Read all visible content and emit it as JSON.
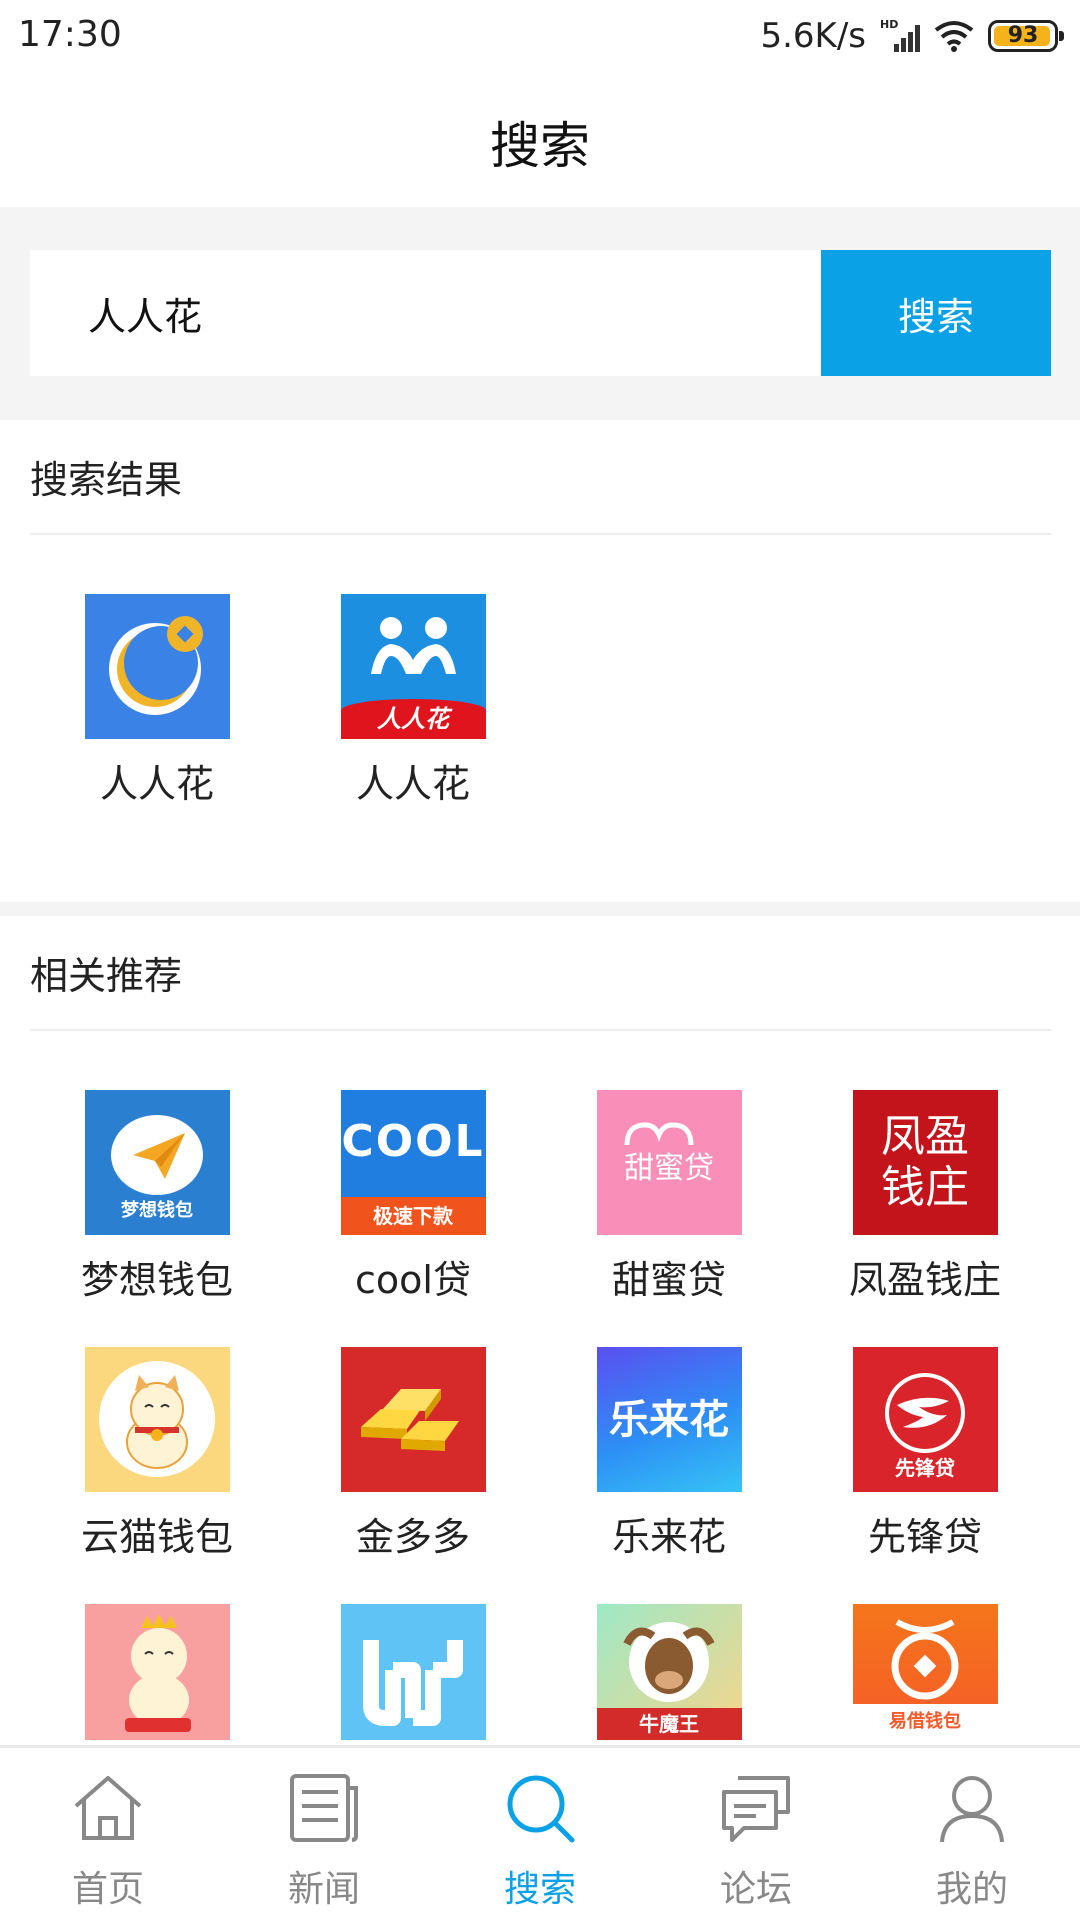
{
  "status_bar": {
    "time": "17:30",
    "net_speed": "5.6K/s",
    "signal_label": "HD",
    "battery": "93",
    "battery_color": "#f5b21b"
  },
  "header": {
    "title": "搜索"
  },
  "search": {
    "value": "人人花",
    "button_label": "搜索",
    "accent_color": "#0aa1e6"
  },
  "results": {
    "title": "搜索结果",
    "items": [
      {
        "label": "人人花",
        "icon": "blue-ring-coin-icon"
      },
      {
        "label": "人人花",
        "icon": "renrenhua-people-icon",
        "icon_text": "人人花"
      }
    ]
  },
  "recommend": {
    "title": "相关推荐",
    "items": [
      {
        "label": "梦想钱包",
        "icon": "paper-plane-icon",
        "icon_text": "梦想钱包"
      },
      {
        "label": "cool贷",
        "icon": "cool-coins-icon",
        "icon_text": "极速下款",
        "icon_word": "COOL"
      },
      {
        "label": "甜蜜贷",
        "icon": "heart-icon",
        "icon_text": "甜蜜贷"
      },
      {
        "label": "凤盈钱庄",
        "icon": "fengying-text-icon",
        "icon_text": "凤盈钱庄"
      },
      {
        "label": "云猫钱包",
        "icon": "lucky-cat-icon"
      },
      {
        "label": "金多多",
        "icon": "gold-bars-icon"
      },
      {
        "label": "乐来花",
        "icon": "lelaihua-text-icon",
        "icon_text": "乐来花"
      },
      {
        "label": "先锋贷",
        "icon": "xianfeng-logo-icon",
        "icon_text": "先锋贷"
      },
      {
        "label": "",
        "icon": "crowned-cat-icon"
      },
      {
        "label": "",
        "icon": "w-logo-icon"
      },
      {
        "label": "",
        "icon": "bull-king-icon",
        "icon_text": "牛魔王"
      },
      {
        "label": "",
        "icon": "yijie-wallet-icon",
        "icon_text": "易借钱包"
      }
    ]
  },
  "bottom_nav": {
    "items": [
      {
        "label": "首页",
        "icon": "home-icon"
      },
      {
        "label": "新闻",
        "icon": "news-icon"
      },
      {
        "label": "搜索",
        "icon": "search-icon",
        "active": true
      },
      {
        "label": "论坛",
        "icon": "forum-icon"
      },
      {
        "label": "我的",
        "icon": "profile-icon"
      }
    ]
  }
}
